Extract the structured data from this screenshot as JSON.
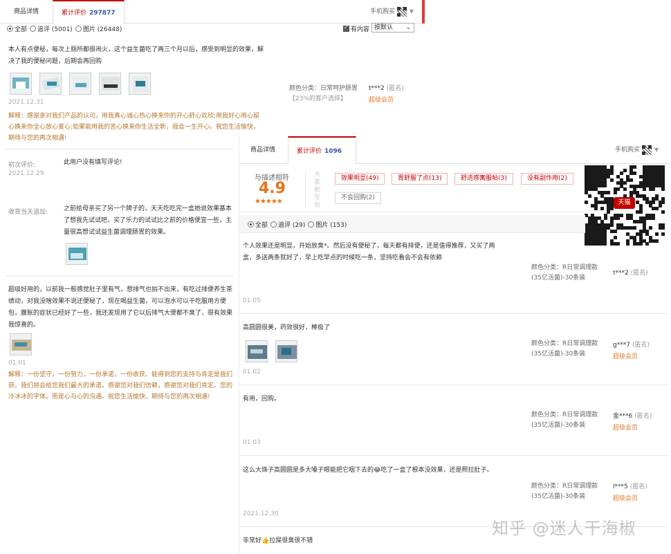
{
  "back": {
    "tabs": {
      "details": "商品详情",
      "reviews": "累计评价",
      "reviews_count": "297877",
      "mobile_buy": "手机购买"
    },
    "filter": {
      "all": "全部",
      "followup": "追评 (5001)",
      "images": "图片 (26448)",
      "has_content": "有内容",
      "sort": "按默认"
    },
    "review1": {
      "text_line1": "本人有点便秘，每次上厕所都很闹火，这个益生菌吃了两三个月以后，感受到明显的效果，解",
      "text_line2": "决了我的便秘问题，后期会再回购",
      "date": "2021.12.31",
      "color_label": "颜色分类：日常呵护肠胃",
      "share": "【23%的客户选择】",
      "user": "t***2",
      "anon": "(匿名)",
      "member": "超级会员",
      "reply_line1": "解释：感谢亲对我们产品的认可。用我真心诚心热心换来你的开心舒心欢欣;用我好心用心留",
      "reply_line2": "心换来你全心放心爱心;如果能用我的苦心换来你生活全新，我会一生开心。祝您生活愉快，",
      "reply_line3": "期待与您的再次相遇!"
    },
    "review2": {
      "initial_label": "初次评价:",
      "initial_text": "此用户没有填写评论!",
      "initial_date": "2021.12.29",
      "append_label": "收货当天追加:",
      "append_line1": "之前给母亲买了另一个牌子的，天天吃吃完一盒她说效果基本",
      "append_line2": "了想我先试试吧，买了乐力的试试比之前的价格便宜一些，主",
      "append_line3": "量很高想试试益生菌调理肠胃的效果。"
    },
    "review3": {
      "text_line1": "超级好用的，以前我一般感觉肚子里有气，想排气也拍不出来，有吃过排便养生茶",
      "text_line2": "绩动，对我没啥效果不说还便秘了，现在喝益生菌，可以泡水可以干吃服用方便",
      "text_line3": "包，腹胀的症状已经好了一些，我还发现用了它以后排气大便都不臭了，很有效果",
      "text_line4": "我惊喜的。",
      "date": "01.01",
      "reply_line1": "解释：一份坚守，一份努力，一份承诺，一份收获。能得到您的支持与肯定是我们",
      "reply_line2": "获。我们将会给您我们最大的承诺。感谢您对我们信赖，感谢您对我们肯定。您的",
      "reply_line3": "冷冰冰的字体。而是心与心的沟通。祝您生活愉快，期待与您的再次相遇!"
    }
  },
  "front": {
    "tabs": {
      "details": "商品详情",
      "reviews": "累计评价",
      "reviews_count": "1096",
      "mobile_buy": "手机购买"
    },
    "rating": {
      "label": "与描述相符",
      "score": "4.9",
      "stars": "★★★★★",
      "side_label": "大家都写到"
    },
    "tags": [
      "效果明显(49)",
      "胃舒服了点(13)",
      "舒适感寓服帖(3)",
      "没有副作用(2)"
    ],
    "tag_neutral": "不会回购(2)",
    "qr_badge": "天猫",
    "filter": {
      "all": "全部",
      "followup": "追评 (29)",
      "images": "图片 (153)"
    },
    "reviews": [
      {
        "line1": "个人效果还是明显，开始放臭*。然后没有便秘了，每天都有排便，还是值得推荐，又买了两",
        "line2": "盒，多送两条就好了，早上吃早点的时候吃一条，坚持吃看会不会有依赖",
        "date": "01.05",
        "meta1": "颜色分类：R日常调理款",
        "meta2": "(35亿活菌)-30条装",
        "user": "t***2",
        "anon": "(匿名)",
        "member": ""
      },
      {
        "line1": "高圆圆很美，药效很好，棒极了",
        "line2": "",
        "date": "01.02",
        "meta1": "颜色分类：R日常调理款",
        "meta2": "(35亿活菌)-30条装",
        "user": "g***7",
        "anon": "(匿名)",
        "member": "超级会员"
      },
      {
        "line1": "有用，回购。",
        "line2": "",
        "date": "01.03",
        "meta1": "颜色分类：R日常调理款",
        "meta2": "(35亿活菌)-30条装",
        "user": "金***6",
        "anon": "(匿名)",
        "member": "超级会员"
      },
      {
        "line1": "这么大珠子高圆圆是多大嗓子眼能把它咽下去的😂吃了一盒了根本没效果，还是照拉肚子。",
        "line2": "",
        "date": "2021.12.30",
        "meta1": "颜色分类：R日常调理款",
        "meta2": "(35亿活菌)-30条装",
        "user": "l***5",
        "anon": "(匿名)",
        "member": "超级会员"
      },
      {
        "line1": "非常好👍拉屎很臭很不错",
        "line2": ""
      }
    ]
  },
  "watermark": "知乎 @迷人干海椒"
}
